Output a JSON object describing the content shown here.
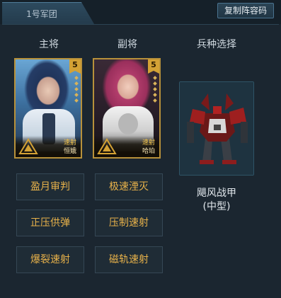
{
  "tab": {
    "label": "1号军团"
  },
  "copy_button": {
    "label": "复制阵容码"
  },
  "columns": {
    "main": "主将",
    "vice": "副将",
    "unit": "兵种选择"
  },
  "cards": [
    {
      "stars": "5",
      "type": "速射",
      "name": "恒娥"
    },
    {
      "stars": "5",
      "type": "速射",
      "name": "哈珀"
    }
  ],
  "unit": {
    "name": "飓风战甲",
    "size": "(中型)"
  },
  "skills": [
    "盈月审判",
    "极速湮灭",
    "正压供弹",
    "压制速射",
    "爆裂速射",
    "磁轨速射"
  ],
  "colors": {
    "accent_gold": "#e8b24a",
    "background": "#1b2630",
    "card_border": "#b8913a"
  }
}
